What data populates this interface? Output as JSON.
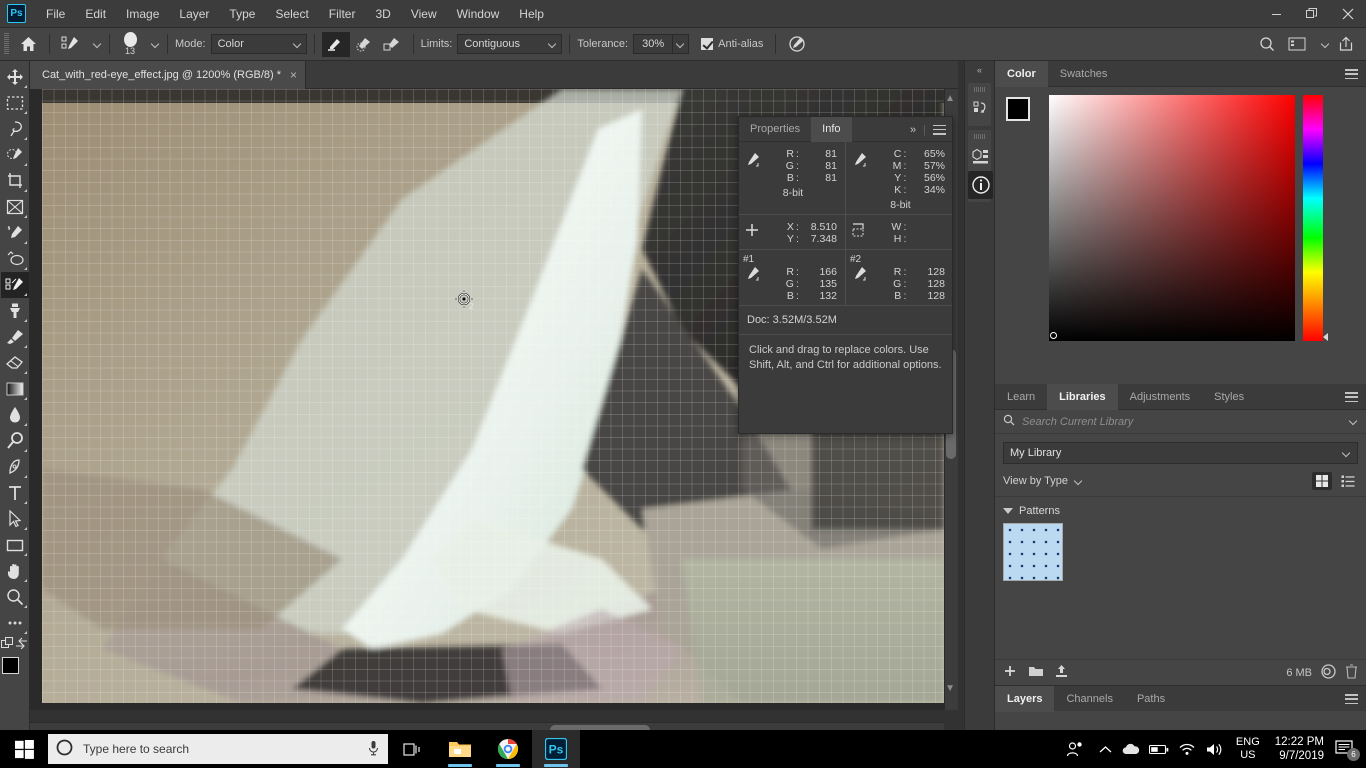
{
  "titlebar": {
    "logo": "Ps",
    "menus": [
      "File",
      "Edit",
      "Image",
      "Layer",
      "Type",
      "Select",
      "Filter",
      "3D",
      "View",
      "Window",
      "Help"
    ],
    "window_controls": [
      "minimize",
      "restore",
      "close"
    ]
  },
  "options_bar": {
    "home_label": "home-icon",
    "tool_preset": "color-replacement-tool-preset",
    "brush_size": "13",
    "mode_label": "Mode:",
    "mode_value": "Color",
    "sampling": [
      "sampling-continuous",
      "sampling-once",
      "sampling-background-swatch"
    ],
    "limits_label": "Limits:",
    "limits_value": "Contiguous",
    "tolerance_label": "Tolerance:",
    "tolerance_value": "30%",
    "antialias_label": "Anti-alias",
    "antialias_checked": true,
    "pressure_label": "pressure-size-icon",
    "right_icons": [
      "search-icon",
      "workspace-icon",
      "chevron-down-icon",
      "share-icon"
    ]
  },
  "toolbar": {
    "tools": [
      {
        "name": "move-tool"
      },
      {
        "name": "rectangular-marquee-tool"
      },
      {
        "name": "lasso-tool"
      },
      {
        "name": "quick-selection-tool"
      },
      {
        "name": "crop-tool"
      },
      {
        "name": "frame-tool"
      },
      {
        "name": "eyedropper-tool"
      },
      {
        "name": "spot-healing-brush-tool"
      },
      {
        "name": "brush-tool"
      },
      {
        "name": "color-replacement-tool",
        "active": true
      },
      {
        "name": "clone-stamp-tool"
      },
      {
        "name": "history-brush-tool"
      },
      {
        "name": "eraser-tool"
      },
      {
        "name": "gradient-tool"
      },
      {
        "name": "blur-tool"
      },
      {
        "name": "dodge-tool"
      },
      {
        "name": "pen-tool"
      },
      {
        "name": "horizontal-type-tool"
      },
      {
        "name": "path-selection-tool"
      },
      {
        "name": "rectangle-tool"
      },
      {
        "name": "hand-tool"
      },
      {
        "name": "zoom-tool"
      },
      {
        "name": "edit-toolbar-tool"
      }
    ],
    "foreground_color": "#000000",
    "background_color": "#ffffff"
  },
  "document": {
    "tab_title": "Cat_with_red-eye_effect.jpg @ 1200% (RGB/8) *",
    "close_label": "×"
  },
  "status_bar": {
    "zoom": "1200%",
    "doc_size": "Doc: 3.52M/3.52M"
  },
  "info_panel": {
    "tabs": [
      {
        "label": "Properties",
        "active": false
      },
      {
        "label": "Info",
        "active": true
      }
    ],
    "collapse_label": "»",
    "rgb": {
      "icon": "eyedropper-icon",
      "rows": [
        {
          "k": "R",
          "v": "81"
        },
        {
          "k": "G",
          "v": "81"
        },
        {
          "k": "B",
          "v": "81"
        }
      ],
      "depth": "8-bit"
    },
    "cmyk": {
      "icon": "eyedropper-icon",
      "rows": [
        {
          "k": "C",
          "v": "65%"
        },
        {
          "k": "M",
          "v": "57%"
        },
        {
          "k": "Y",
          "v": "56%"
        },
        {
          "k": "K",
          "v": "34%"
        }
      ],
      "depth": "8-bit"
    },
    "position": {
      "icon": "crosshair-icon",
      "rows": [
        {
          "k": "X",
          "v": "8.510"
        },
        {
          "k": "Y",
          "v": "7.348"
        }
      ]
    },
    "size": {
      "icon": "marquee-icon",
      "rows": [
        {
          "k": "W",
          "v": ""
        },
        {
          "k": "H",
          "v": ""
        }
      ]
    },
    "sampler1": {
      "tag": "#1",
      "icon": "eyedropper-icon",
      "rows": [
        {
          "k": "R",
          "v": "166"
        },
        {
          "k": "G",
          "v": "135"
        },
        {
          "k": "B",
          "v": "132"
        }
      ]
    },
    "sampler2": {
      "tag": "#2",
      "icon": "eyedropper-icon",
      "rows": [
        {
          "k": "R",
          "v": "128"
        },
        {
          "k": "G",
          "v": "128"
        },
        {
          "k": "B",
          "v": "128"
        }
      ]
    },
    "doc_line": "Doc: 3.52M/3.52M",
    "hint": "Click and drag to replace colors.  Use Shift, Alt, and Ctrl for additional options."
  },
  "dock_rail": {
    "collapse": "«",
    "buttons": [
      {
        "name": "history-panel-icon",
        "active": false
      },
      {
        "name": "properties-panel-icon",
        "active": false
      },
      {
        "name": "info-panel-icon",
        "active": true
      }
    ]
  },
  "color_panel": {
    "tabs": [
      {
        "label": "Color",
        "active": true
      },
      {
        "label": "Swatches",
        "active": false
      }
    ],
    "foreground_color": "#000000",
    "background_color": "#ffffff",
    "hue": "#ff0000"
  },
  "libraries_panel": {
    "tabs": [
      {
        "label": "Learn",
        "active": false
      },
      {
        "label": "Libraries",
        "active": true
      },
      {
        "label": "Adjustments",
        "active": false
      },
      {
        "label": "Styles",
        "active": false
      }
    ],
    "search_placeholder": "Search Current Library",
    "library_name": "My Library",
    "view_label": "View by Type",
    "group_label": "Patterns",
    "items": [
      {
        "name": "pattern-thumbnail"
      }
    ],
    "footer": {
      "add_label": "add-content-icon",
      "folder_label": "new-group-icon",
      "upload_label": "upload-icon",
      "size": "6 MB",
      "cloud_label": "creative-cloud-icon",
      "delete_label": "delete-icon"
    }
  },
  "layers_panel": {
    "tabs": [
      {
        "label": "Layers",
        "active": true
      },
      {
        "label": "Channels",
        "active": false
      },
      {
        "label": "Paths",
        "active": false
      }
    ]
  },
  "taskbar": {
    "start_label": "start-button",
    "search_placeholder": "Type here to search",
    "mic_label": "microphone-icon",
    "taskview_label": "task-view-icon",
    "apps": [
      {
        "name": "file-explorer",
        "running": true,
        "active": false
      },
      {
        "name": "google-chrome",
        "running": true,
        "active": false
      },
      {
        "name": "adobe-photoshop",
        "running": true,
        "active": true
      }
    ],
    "tray": {
      "people_label": "people-icon",
      "chevron_label": "show-hidden-icons",
      "onedrive_label": "onedrive-icon",
      "battery_label": "battery-icon",
      "wifi_label": "wifi-icon",
      "volume_label": "volume-icon",
      "lang_line1": "ENG",
      "lang_line2": "US",
      "time": "12:22 PM",
      "date": "9/7/2019",
      "notifications": "6"
    }
  }
}
